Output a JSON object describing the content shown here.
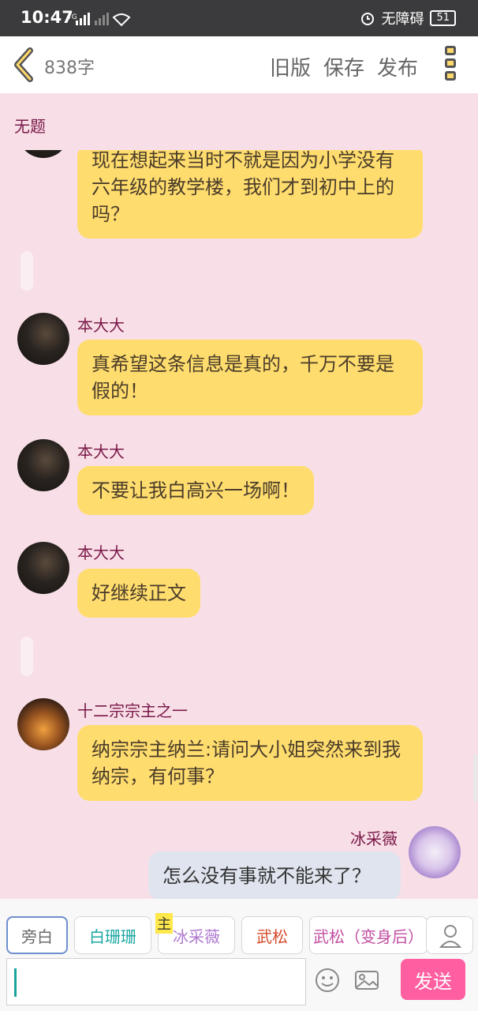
{
  "status": {
    "time": "10:47",
    "network": "4G",
    "accessibility_label": "无障碍",
    "battery": "51"
  },
  "header": {
    "word_count": "838字",
    "old_version": "旧版",
    "save": "保存",
    "publish": "发布"
  },
  "chat": {
    "title": "无题",
    "messages": [
      {
        "text": "现在想起来当时不就是因为小学没有六年级的教学楼，我们才到初中上的吗？"
      },
      {
        "name": "本大大",
        "text": "真希望这条信息是真的，千万不要是假的！"
      },
      {
        "name": "本大大",
        "text": "不要让我白高兴一场啊！"
      },
      {
        "name": "本大大",
        "text": "好继续正文"
      },
      {
        "name": "十二宗宗主之一",
        "text": "纳宗宗主纳兰:请问大小姐突然来到我纳宗，有何事？"
      },
      {
        "name": "冰采薇",
        "text": "怎么没有事就不能来了？"
      }
    ]
  },
  "roles": {
    "items": [
      {
        "label": "旁白",
        "color": "#6b6b6b"
      },
      {
        "label": "白珊珊",
        "color": "#1aa7a0"
      },
      {
        "label": "冰采薇",
        "color": "#b07ad0"
      },
      {
        "label": "武松",
        "color": "#d44a2a"
      },
      {
        "label": "武松（变身后）",
        "color": "#c24fa2"
      }
    ],
    "main_badge": "主"
  },
  "input": {
    "send": "发送"
  },
  "colors": {
    "background": "#f8dfe7",
    "bubble_left": "#ffdc6e",
    "bubble_right": "#dfe4ee",
    "name": "#7a1848",
    "send_button": "#ff5fa0"
  }
}
